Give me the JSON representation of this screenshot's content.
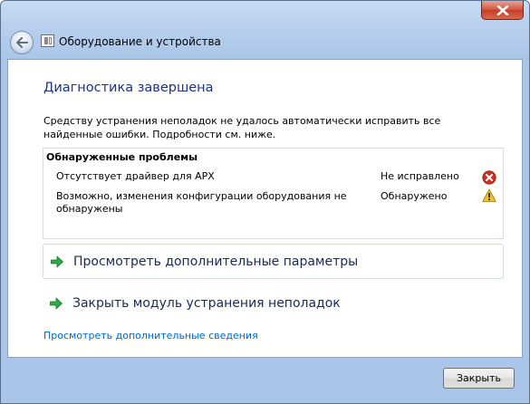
{
  "window": {
    "title": "Оборудование и устройства"
  },
  "main": {
    "heading": "Диагностика завершена",
    "description": "Средству устранения неполадок не удалось автоматически исправить все найденные ошибки. Подробности см. ниже."
  },
  "problems": {
    "title": "Обнаруженные проблемы",
    "items": [
      {
        "text": "Отсутствует драйвер для APX",
        "status": "Не исправлено",
        "icon": "error-icon"
      },
      {
        "text": "Возможно, изменения конфигурации оборудования не обнаружены",
        "status": "Обнаружено",
        "icon": "warning-icon"
      }
    ]
  },
  "commands": [
    {
      "label": "Просмотреть дополнительные параметры",
      "icon": "green-arrow-icon"
    },
    {
      "label": "Закрыть модуль устранения неполадок",
      "icon": "green-arrow-icon"
    }
  ],
  "link": {
    "label": "Просмотреть дополнительные сведения"
  },
  "footer": {
    "close_label": "Закрыть"
  },
  "colors": {
    "heading": "#1e3287",
    "link": "#0066cc",
    "error": "#d0301f",
    "warning": "#f3c41c",
    "arrow": "#2fa84a"
  }
}
